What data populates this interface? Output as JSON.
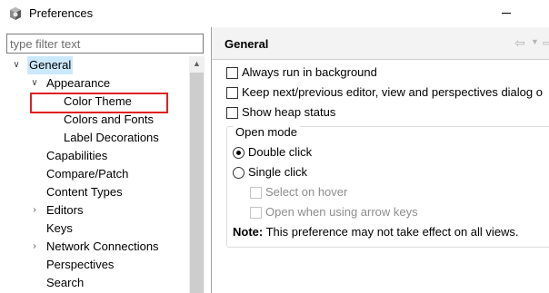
{
  "window": {
    "title": "Preferences"
  },
  "filter": {
    "placeholder": "type filter text",
    "value": ""
  },
  "tree": [
    {
      "label": "General",
      "expanded": true,
      "selected": true
    },
    {
      "label": "Appearance",
      "expanded": true
    },
    {
      "label": "Color Theme",
      "highlighted": true
    },
    {
      "label": "Colors and Fonts"
    },
    {
      "label": "Label Decorations"
    },
    {
      "label": "Capabilities"
    },
    {
      "label": "Compare/Patch"
    },
    {
      "label": "Content Types"
    },
    {
      "label": "Editors",
      "expanded": false
    },
    {
      "label": "Keys"
    },
    {
      "label": "Network Connections",
      "expanded": false
    },
    {
      "label": "Perspectives"
    },
    {
      "label": "Search"
    }
  ],
  "page": {
    "title": "General",
    "checkboxes": [
      {
        "label": "Always run in background",
        "checked": false
      },
      {
        "label": "Keep next/previous editor, view and perspectives dialog o",
        "checked": false
      },
      {
        "label": "Show heap status",
        "checked": false
      }
    ],
    "open_mode": {
      "legend": "Open mode",
      "double_click": "Double click",
      "single_click": "Single click",
      "selected": "double_click",
      "select_on_hover": "Select on hover",
      "open_arrow_keys": "Open when using arrow keys"
    },
    "note_label": "Note:",
    "note_text": " This preference may not take effect on all views."
  },
  "colors": {
    "selection": "#cce8ff",
    "highlight_box": "#e02020"
  },
  "icons": {
    "window": "gear-cube-icon",
    "back": "back-arrow-icon",
    "forward": "forward-arrow-icon"
  }
}
